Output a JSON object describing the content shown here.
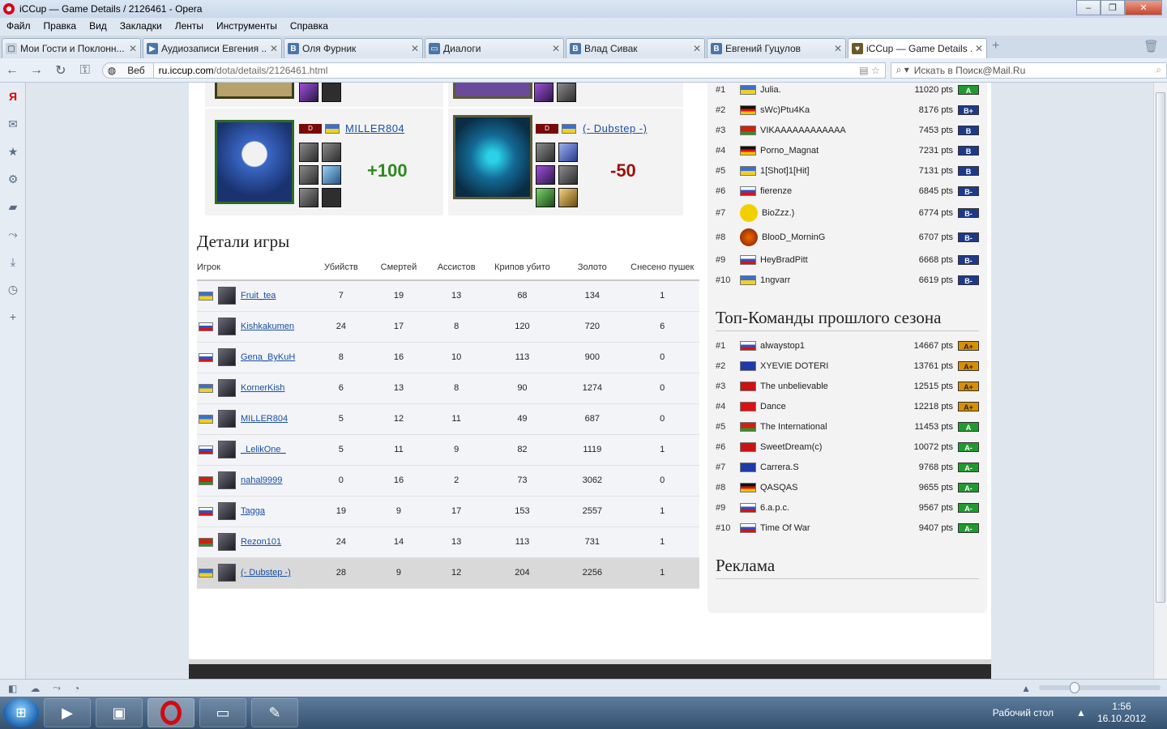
{
  "window": {
    "title": "iCCup — Game Details / 2126461 - Opera"
  },
  "menu": [
    "Файл",
    "Правка",
    "Вид",
    "Закладки",
    "Ленты",
    "Инструменты",
    "Справка"
  ],
  "tabs": [
    {
      "label": "Мои Гости и Поклонн...",
      "icon": "page-icon"
    },
    {
      "label": "Аудиозаписи Евгения ...",
      "icon": "play-icon"
    },
    {
      "label": "Оля Фурник",
      "icon": "vk-icon"
    },
    {
      "label": "Диалоги",
      "icon": "chat-icon"
    },
    {
      "label": "Влад Сивак",
      "icon": "vk-icon"
    },
    {
      "label": "Евгений Гуцулов",
      "icon": "vk-icon"
    },
    {
      "label": "iCCup — Game Details ...",
      "icon": "iccup-icon",
      "active": true
    }
  ],
  "address": {
    "web_label": "Веб",
    "url_host": "ru.iccup.com",
    "url_path": "/dota/details/2126461.html",
    "search_placeholder": "Искать в Поиск@Mail.Ru"
  },
  "heroes": [
    {
      "name": "MILLER804",
      "delta": "+100",
      "flag": "ua",
      "badge": "D",
      "result": "positive"
    },
    {
      "name": "(- Dubstep -)",
      "delta": "-50",
      "flag": "ua",
      "badge": "D",
      "result": "negative"
    }
  ],
  "details": {
    "title": "Детали игры",
    "columns": [
      "Игрок",
      "Убийств",
      "Смертей",
      "Ассистов",
      "Крипов убито",
      "Золото",
      "Снесено пушек"
    ],
    "rows": [
      {
        "player": "Fruit_tea",
        "flag": "ua",
        "kills": "7",
        "deaths": "19",
        "assists": "13",
        "creeps": "68",
        "gold": "134",
        "towers": "1"
      },
      {
        "player": "Kishkakumen",
        "flag": "ru",
        "kills": "24",
        "deaths": "17",
        "assists": "8",
        "creeps": "120",
        "gold": "720",
        "towers": "6"
      },
      {
        "player": "Gena_ByKuH",
        "flag": "ru",
        "kills": "8",
        "deaths": "16",
        "assists": "10",
        "creeps": "113",
        "gold": "900",
        "towers": "0"
      },
      {
        "player": "KornerKish",
        "flag": "ua",
        "kills": "6",
        "deaths": "13",
        "assists": "8",
        "creeps": "90",
        "gold": "1274",
        "towers": "0"
      },
      {
        "player": "MILLER804",
        "flag": "ua",
        "kills": "5",
        "deaths": "12",
        "assists": "11",
        "creeps": "49",
        "gold": "687",
        "towers": "0"
      },
      {
        "player": "_LelikOne_",
        "flag": "ru",
        "kills": "5",
        "deaths": "11",
        "assists": "9",
        "creeps": "82",
        "gold": "1119",
        "towers": "1"
      },
      {
        "player": "nahal9999",
        "flag": "by",
        "kills": "0",
        "deaths": "16",
        "assists": "2",
        "creeps": "73",
        "gold": "3062",
        "towers": "0"
      },
      {
        "player": "Tagga",
        "flag": "ru",
        "kills": "19",
        "deaths": "9",
        "assists": "17",
        "creeps": "153",
        "gold": "2557",
        "towers": "1"
      },
      {
        "player": "Rezon101",
        "flag": "by",
        "kills": "24",
        "deaths": "14",
        "assists": "13",
        "creeps": "113",
        "gold": "731",
        "towers": "1"
      },
      {
        "player": "(- Dubstep -)",
        "flag": "ua",
        "kills": "28",
        "deaths": "9",
        "assists": "12",
        "creeps": "204",
        "gold": "2256",
        "towers": "1"
      }
    ]
  },
  "top_players": [
    {
      "rank": "#1",
      "name": "Julia.",
      "pts": "11020 pts",
      "badge": "A",
      "flag": "ua"
    },
    {
      "rank": "#2",
      "name": "sWc)Ptu4Ka",
      "pts": "8176 pts",
      "badge": "B+",
      "flag": "de"
    },
    {
      "rank": "#3",
      "name": "VIKAAAAAAAAAAAA",
      "pts": "7453 pts",
      "badge": "B",
      "flag": "by"
    },
    {
      "rank": "#4",
      "name": "Porno_Magnat",
      "pts": "7231 pts",
      "badge": "B",
      "flag": "de"
    },
    {
      "rank": "#5",
      "name": "1[Shot]1[Hit]",
      "pts": "7131 pts",
      "badge": "B",
      "flag": "ua"
    },
    {
      "rank": "#6",
      "name": "fierenze",
      "pts": "6845 pts",
      "badge": "B-",
      "flag": "ru"
    },
    {
      "rank": "#7",
      "name": "BioZzz.)",
      "pts": "6774 pts",
      "badge": "B-",
      "flag": "pacman"
    },
    {
      "rank": "#8",
      "name": "BlooD_MorninG",
      "pts": "6707 pts",
      "badge": "B-",
      "flag": "avatar"
    },
    {
      "rank": "#9",
      "name": "HeyBradPitt",
      "pts": "6668 pts",
      "badge": "B-",
      "flag": "ru"
    },
    {
      "rank": "#10",
      "name": "1ngvarr",
      "pts": "6619 pts",
      "badge": "B-",
      "flag": "ua"
    }
  ],
  "top_teams": {
    "title": "Топ-Команды прошлого сезона",
    "rows": [
      {
        "rank": "#1",
        "name": "alwaystop1",
        "pts": "14667 pts",
        "badge": "A+",
        "flag": "ru"
      },
      {
        "rank": "#2",
        "name": "XYEVIE DOTERI",
        "pts": "13761 pts",
        "badge": "A+",
        "flag": "eu"
      },
      {
        "rank": "#3",
        "name": "The unbelievable",
        "pts": "12515 pts",
        "badge": "A+",
        "flag": "no"
      },
      {
        "rank": "#4",
        "name": "Dance",
        "pts": "12218 pts",
        "badge": "A+",
        "flag": "ch"
      },
      {
        "rank": "#5",
        "name": "The International",
        "pts": "11453 pts",
        "badge": "A",
        "flag": "by"
      },
      {
        "rank": "#6",
        "name": "SweetDream(c)",
        "pts": "10072 pts",
        "badge": "A-",
        "flag": "no"
      },
      {
        "rank": "#7",
        "name": "Carrera.S",
        "pts": "9768 pts",
        "badge": "A-",
        "flag": "eu"
      },
      {
        "rank": "#8",
        "name": "QASQAS",
        "pts": "9655 pts",
        "badge": "A-",
        "flag": "de"
      },
      {
        "rank": "#9",
        "name": "6.a.p.c.",
        "pts": "9567 pts",
        "badge": "A-",
        "flag": "ru"
      },
      {
        "rank": "#10",
        "name": "Time Of War",
        "pts": "9407 pts",
        "badge": "A-",
        "flag": "ru"
      }
    ]
  },
  "ads": {
    "title": "Реклама"
  },
  "taskbar": {
    "desktop_label": "Рабочий стол",
    "time": "1:56",
    "date": "16.10.2012"
  }
}
